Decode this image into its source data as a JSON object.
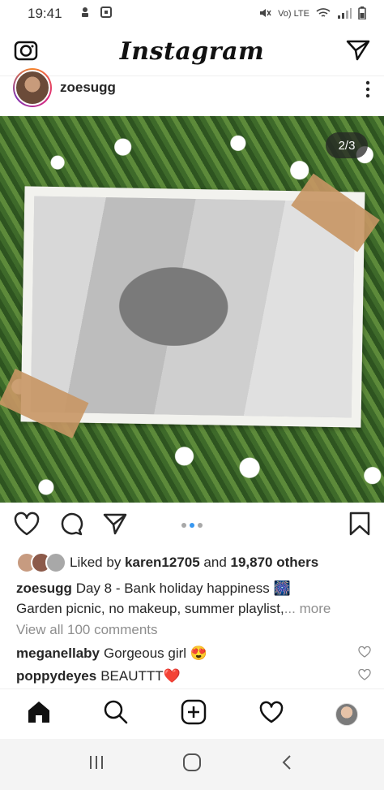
{
  "status_bar": {
    "time": "19:41",
    "network_label": "Vo) LTE",
    "icons": [
      "notification-icon",
      "screen-icon",
      "mute-icon",
      "wifi-icon",
      "signal-icon",
      "battery-icon"
    ]
  },
  "header": {
    "logo": "Instagram",
    "left_icon": "camera-icon",
    "right_icon": "direct-message-icon"
  },
  "post": {
    "username": "zoesugg",
    "image_counter": "2/3",
    "carousel": {
      "current": 2,
      "total": 3
    },
    "likes": {
      "prefix": "Liked by ",
      "liker": "karen12705",
      "middle": " and ",
      "count": "19,870 others"
    },
    "caption": {
      "username": "zoesugg",
      "text": "Day 8 - Bank holiday happiness 🎆",
      "line2": "Garden picnic, no makeup, summer playlist,",
      "more": "... more"
    },
    "view_comments": "View all 100 comments",
    "comments": [
      {
        "username": "meganellaby",
        "text": "Gorgeous girl 😍"
      },
      {
        "username": "poppydeyes",
        "text": "BEAUTTT❤️"
      }
    ]
  },
  "bottom_nav": {
    "items": [
      "home-icon",
      "search-icon",
      "new-post-icon",
      "activity-heart-icon",
      "profile-avatar"
    ]
  },
  "system_nav": {
    "items": [
      "recent-apps-icon",
      "home-button-icon",
      "back-icon"
    ]
  },
  "colors": {
    "accent_blue": "#3897f0",
    "text_primary": "#262626",
    "text_secondary": "#8e8e8e",
    "heart_red": "#ed4956"
  }
}
